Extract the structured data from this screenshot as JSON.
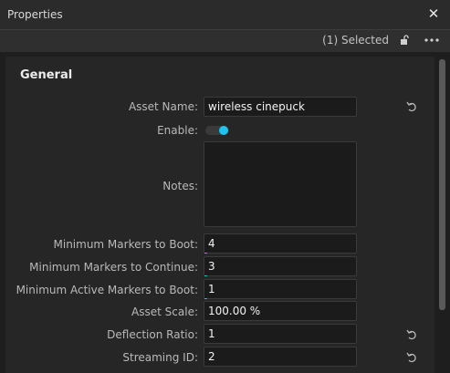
{
  "window": {
    "title": "Properties",
    "close_glyph": "✕"
  },
  "toolbar": {
    "selected_text": "(1) Selected"
  },
  "section": {
    "title": "General"
  },
  "fields": {
    "asset_name": {
      "label": "Asset Name:",
      "value": "wireless cinepuck"
    },
    "enable": {
      "label": "Enable:",
      "value": "on"
    },
    "notes": {
      "label": "Notes:",
      "value": ""
    },
    "min_markers_boot": {
      "label": "Minimum Markers to Boot:",
      "value": "4"
    },
    "min_markers_continue": {
      "label": "Minimum Markers to Continue:",
      "value": "3"
    },
    "min_active_markers_boot": {
      "label": "Minimum Active Markers to Boot:",
      "value": "1"
    },
    "asset_scale": {
      "label": "Asset Scale:",
      "value": "100.00 %"
    },
    "deflection_ratio": {
      "label": "Deflection Ratio:",
      "value": "1"
    },
    "streaming_id": {
      "label": "Streaming ID:",
      "value": "2"
    }
  },
  "icons": {
    "close": "close-icon",
    "lock": "lock-icon",
    "more": "more-icon",
    "reset": "reset-icon"
  },
  "colors": {
    "accent": "#1fc3ef",
    "background": "#1e1e1e",
    "panel": "#262626",
    "field": "#1b1b1b"
  }
}
